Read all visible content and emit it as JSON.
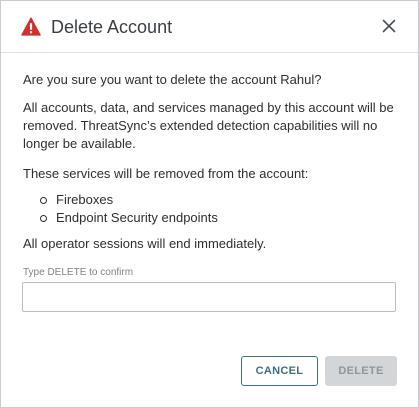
{
  "dialog": {
    "title": "Delete Account",
    "title_icon": "warning-triangle-icon",
    "close_icon": "close-icon",
    "warning_color": "#d0312d"
  },
  "body": {
    "question": "Are you sure you want to delete the account Rahul?",
    "notice": "All accounts, data, and services managed by this account will be removed. ThreatSync’s extended detection capabilities will no longer be available.",
    "services_heading": "These services will be removed from the account:",
    "services": [
      "Fireboxes",
      "Endpoint Security endpoints"
    ],
    "sessions_note": "All operator sessions will end immediately."
  },
  "confirm": {
    "label": "Type DELETE to confirm",
    "value": ""
  },
  "buttons": {
    "cancel_label": "CANCEL",
    "delete_label": "DELETE",
    "delete_enabled": false,
    "cancel_color": "#3e6f83"
  }
}
